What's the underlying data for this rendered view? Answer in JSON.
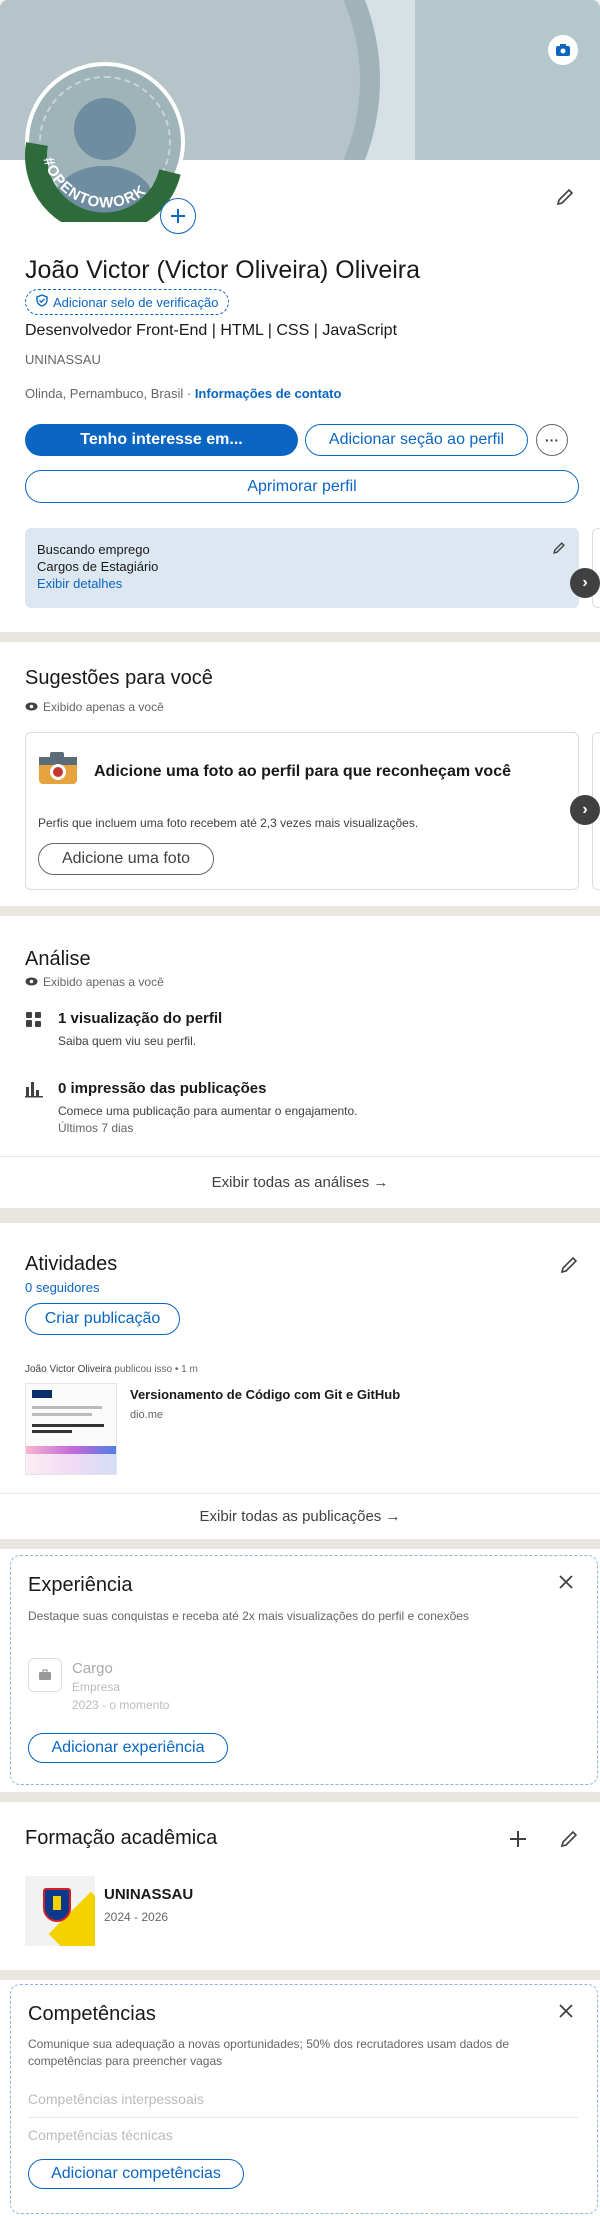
{
  "profile": {
    "name": "João Victor (Victor Oliveira) Oliveira",
    "verify_label": "Adicionar selo de verificação",
    "headline": "Desenvolvedor Front-End | HTML | CSS | JavaScript",
    "school": "UNINASSAU",
    "location": "Olinda, Pernambuco, Brasil",
    "location_sep": " · ",
    "contact_link": "Informações de contato",
    "open_to_work_badge": "#OPENTOWORK",
    "btn_interest": "Tenho interesse em...",
    "btn_add_section": "Adicionar seção ao perfil",
    "btn_more": "···",
    "btn_improve": "Aprimorar perfil",
    "job_status": {
      "title": "Buscando emprego",
      "roles": "Cargos de Estagiário",
      "details_link": "Exibir detalhes"
    }
  },
  "suggestions": {
    "title": "Sugestões para você",
    "visibility": "Exibido apenas a você",
    "card_title": "Adicione uma foto ao perfil para que reconheçam você",
    "card_desc": "Perfis que incluem uma foto recebem até 2,3 vezes mais visualizações.",
    "card_button": "Adicione uma foto"
  },
  "analytics": {
    "title": "Análise",
    "visibility": "Exibido apenas a você",
    "item1_title": "1 visualização do perfil",
    "item1_desc": "Saiba quem viu seu perfil.",
    "item2_title": "0 impressão das publicações",
    "item2_desc": "Comece uma publicação para aumentar o engajamento.",
    "item2_sub": "Últimos 7 dias",
    "footer_link": "Exibir todas as análises →"
  },
  "activity": {
    "title": "Atividades",
    "followers": "0 seguidores",
    "create_post": "Criar publicação",
    "post_author": "João Victor Oliveira",
    "post_meta": " publicou isso • 1 m",
    "post_title": "Versionamento de Código com Git e GitHub",
    "post_source": "dio.me",
    "footer_link": "Exibir todas as publicações →"
  },
  "experience": {
    "title": "Experiência",
    "desc": "Destaque suas conquistas e receba até 2x mais visualizações do perfil e conexões",
    "placeholder_role": "Cargo",
    "placeholder_company": "Empresa",
    "placeholder_dates": "2023 - o momento",
    "button": "Adicionar experiência"
  },
  "education": {
    "title": "Formação acadêmica",
    "school": "UNINASSAU",
    "dates": "2024 - 2026"
  },
  "skills": {
    "title": "Competências",
    "desc": "Comunique sua adequação a novas oportunidades; 50% dos recrutadores usam dados de competências para preencher vagas",
    "placeholder1": "Competências interpessoais",
    "placeholder2": "Competências técnicas",
    "button": "Adicionar competências"
  },
  "colors": {
    "brand": "#0a66c2",
    "open_to_work_green": "#2e6b3a",
    "job_status_bg": "#dde7f1"
  }
}
